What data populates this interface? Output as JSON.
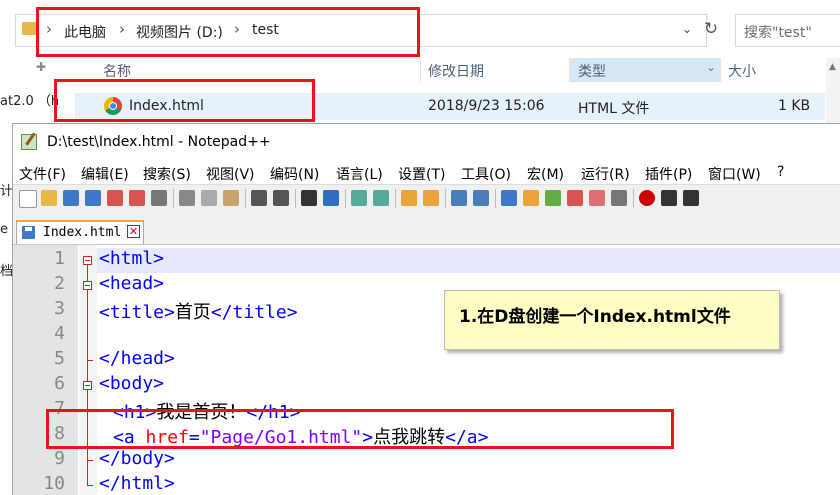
{
  "explorer": {
    "breadcrumb": [
      "此电脑",
      "视频图片 (D:)",
      "test"
    ],
    "search_placeholder": "搜索\"test\"",
    "columns": [
      "名称",
      "修改日期",
      "类型",
      "大小"
    ],
    "file": {
      "name": "Index.html",
      "modified": "2018/9/23 15:06",
      "type": "HTML 文件",
      "size": "1 KB"
    },
    "left_pane": [
      "at2.0 （h",
      "计",
      "e",
      "档"
    ]
  },
  "notepad": {
    "title": "D:\\test\\Index.html - Notepad++",
    "menus": [
      "文件(F)",
      "编辑(E)",
      "搜索(S)",
      "视图(V)",
      "编码(N)",
      "语言(L)",
      "设置(T)",
      "工具(O)",
      "宏(M)",
      "运行(R)",
      "插件(P)",
      "窗口(W)",
      "?"
    ],
    "tab_label": "Index.html",
    "current_line": 1
  },
  "code_lines": [
    {
      "n": "1",
      "tag_open": "<html>"
    },
    {
      "n": "2",
      "tag_open": "<head>"
    },
    {
      "n": "3",
      "t1": "<title>",
      "text": "首页",
      "t2": "</title>"
    },
    {
      "n": "4"
    },
    {
      "n": "5",
      "tag_open": "</head>"
    },
    {
      "n": "6",
      "tag_open": "<body>"
    },
    {
      "n": "7",
      "t1": "<h1>",
      "text": "我是首页！",
      "t2": "</h1>"
    },
    {
      "n": "8",
      "t1": "<a ",
      "attr": "href",
      "eq": "=",
      "val": "\"Page/Go1.html\"",
      "t1b": ">",
      "text": "点我跳转",
      "t2": "</a>"
    },
    {
      "n": "9",
      "tag_open": "</body>"
    },
    {
      "n": "10",
      "tag_open": "</html>"
    }
  ],
  "annotation": {
    "callout_text": "1.在D盘创建一个Index.html文件"
  },
  "colors": {
    "highlight_red": "#e8141b",
    "callout_bg": "#ffffc4",
    "tag_blue": "#0000ff",
    "attr_red": "#ff0000",
    "string_purple": "#8000ff"
  }
}
